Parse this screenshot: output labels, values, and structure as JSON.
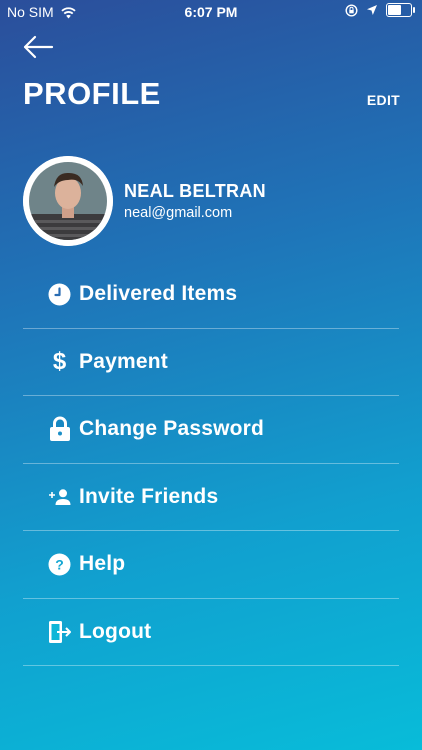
{
  "status_bar": {
    "carrier": "No SIM",
    "time": "6:07 PM"
  },
  "header": {
    "title": "PROFILE",
    "edit_label": "EDIT"
  },
  "profile": {
    "name": "NEAL BELTRAN",
    "email": "neal@gmail.com"
  },
  "menu": {
    "items": [
      {
        "label": "Delivered Items",
        "icon": "clock-icon"
      },
      {
        "label": "Payment",
        "icon": "dollar-icon"
      },
      {
        "label": "Change Password",
        "icon": "lock-icon"
      },
      {
        "label": "Invite Friends",
        "icon": "add-person-icon"
      },
      {
        "label": "Help",
        "icon": "help-icon"
      },
      {
        "label": "Logout",
        "icon": "logout-icon"
      }
    ]
  },
  "colors": {
    "gradient_top": "#2b4e9b",
    "gradient_bottom": "#08bcd9",
    "text": "#ffffff"
  }
}
